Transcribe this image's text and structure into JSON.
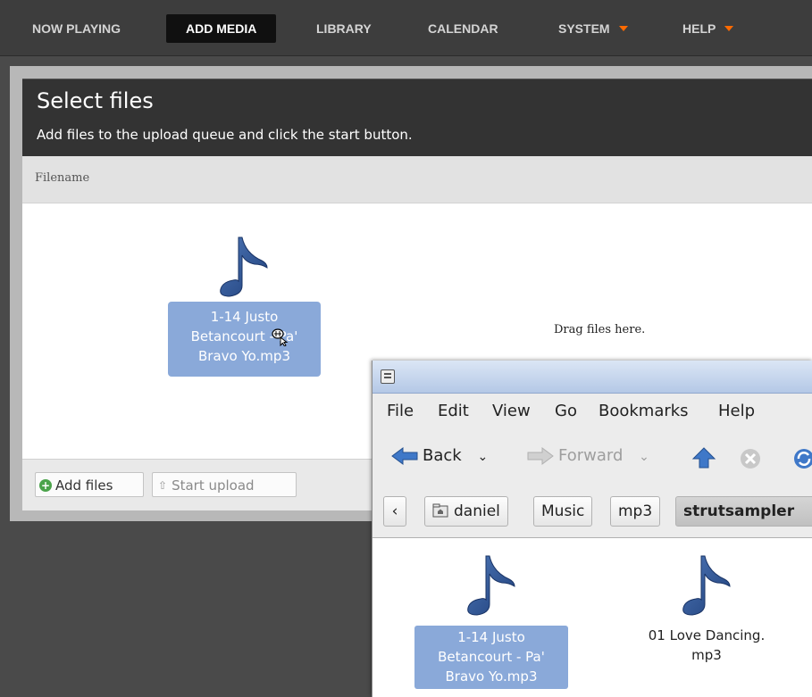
{
  "nav": {
    "items": [
      {
        "label": "NOW PLAYING"
      },
      {
        "label": "ADD MEDIA",
        "active": true
      },
      {
        "label": "LIBRARY"
      },
      {
        "label": "CALENDAR"
      },
      {
        "label": "SYSTEM",
        "dropdown": true
      },
      {
        "label": "HELP",
        "dropdown": true
      }
    ],
    "accent_color": "#ff6a00"
  },
  "upload": {
    "title": "Select files",
    "subtitle": "Add files to the upload queue and click the start button.",
    "column_header": "Filename",
    "drop_hint": "Drag files here.",
    "add_files_label": "Add files",
    "start_upload_label": "Start upload",
    "dragged_file_lines": [
      "1-14 Justo",
      "Betancourt - Pa'",
      "Bravo Yo.mp3"
    ]
  },
  "file_manager": {
    "menu": [
      "File",
      "Edit",
      "View",
      "Go",
      "Bookmarks",
      "Help"
    ],
    "toolbar": {
      "back": "Back",
      "forward": "Forward"
    },
    "path": [
      "daniel",
      "Music",
      "mp3",
      "strutsampler"
    ],
    "files": [
      {
        "lines": [
          "1-14 Justo",
          "Betancourt - Pa'",
          "Bravo Yo.mp3"
        ],
        "selected": true
      },
      {
        "lines": [
          "01 Love Dancing.",
          "mp3"
        ],
        "selected": false
      }
    ],
    "selection_color": "#8aa9d9"
  }
}
